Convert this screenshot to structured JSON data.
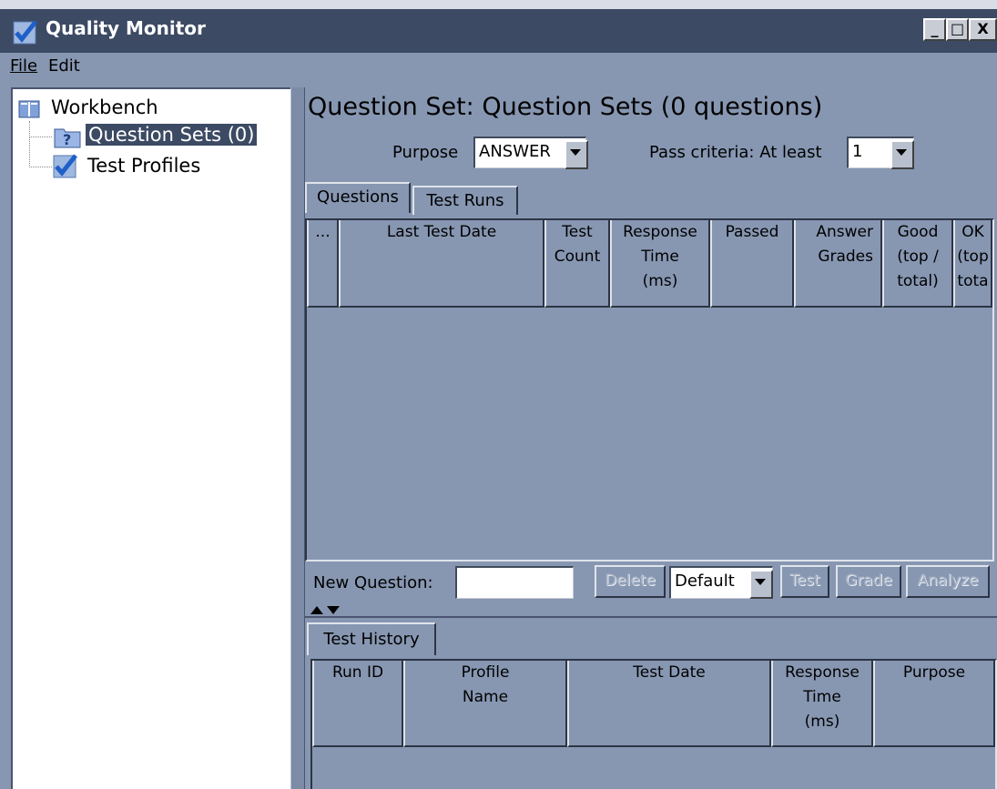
{
  "window": {
    "title": "Quality Monitor",
    "minimize_label": "_",
    "maximize_label": "□",
    "close_label": "X"
  },
  "menu": {
    "items": [
      "File",
      "Edit"
    ]
  },
  "tree": {
    "root": "Workbench",
    "children": [
      {
        "label": "Question Sets (0)",
        "selected": true,
        "icon": "question-folder-icon"
      },
      {
        "label": "Test Profiles",
        "selected": false,
        "icon": "checkmark-icon"
      }
    ]
  },
  "question_set": {
    "title": "Question Set: Question Sets (0 questions)",
    "purpose_label": "Purpose",
    "purpose_value": "ANSWER",
    "pass_criteria_label": "Pass criteria: At least",
    "pass_criteria_value": "1"
  },
  "tabs": [
    {
      "label": "Questions",
      "active": true
    },
    {
      "label": "Test Runs",
      "active": false
    }
  ],
  "questions_table": {
    "columns": [
      "...",
      "Last Test Date",
      "Test\nCount",
      "Response\nTime\n(ms)",
      "Passed",
      "Answer\nGrades",
      "Good\n(top /\ntotal)",
      "OK\n(top\ntota"
    ],
    "rows": []
  },
  "toolbar": {
    "new_question_label": "New Question:",
    "new_question_value": "",
    "delete_label": "Delete",
    "profile_value": "Default",
    "test_label": "Test",
    "grade_label": "Grade",
    "analyze_label": "Analyze"
  },
  "history": {
    "tab_label": "Test History",
    "columns": [
      "Run ID",
      "Profile\nName",
      "Test Date",
      "Response\nTime\n(ms)",
      "Purpose"
    ],
    "rows": []
  },
  "colors": {
    "background": "#8797b2",
    "titlebar": "#3c4a63",
    "selection": "#3c4a63",
    "accent_check": "#2b6bd6"
  }
}
